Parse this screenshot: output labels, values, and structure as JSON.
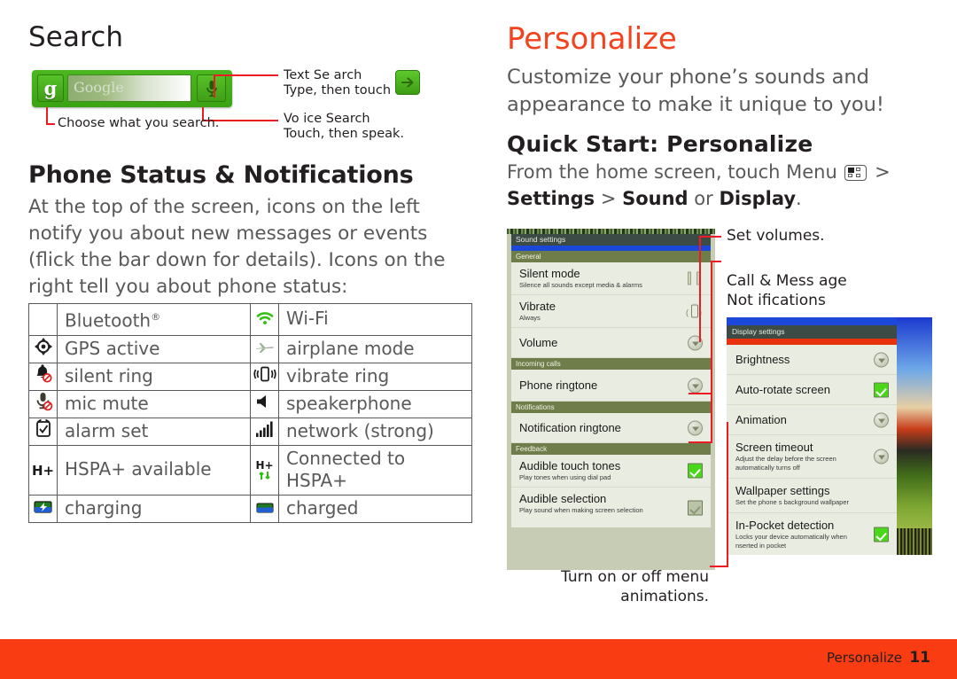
{
  "left": {
    "search_heading": "Search",
    "widget": {
      "g_letter": "g",
      "field_placeholder": "Google",
      "mic_icon": "microphone-icon",
      "g_icon": "google-source-icon"
    },
    "callouts": {
      "text_search_title": "Text Se arch",
      "text_search_sub": "Type, then touch",
      "go_icon": "go-arrow-icon",
      "voice_search_title": "Vo ice Search",
      "voice_search_sub": "Touch, then speak.",
      "choose_what": "Choose what you search."
    },
    "status_heading": "Phone Status & Notifications",
    "status_body": "At the top of the screen, icons on the left notify you about new messages or events (flick the bar down for details). Icons on the right tell you about phone status:",
    "table": {
      "rows": [
        {
          "left_icon": "bluetooth-icon",
          "left_label": "Bluetooth",
          "left_sup": "®",
          "right_icon": "wifi-icon",
          "right_label": "Wi-Fi"
        },
        {
          "left_icon": "gps-icon",
          "left_label": "GPS active",
          "left_sup": "",
          "right_icon": "airplane-icon",
          "right_label": "airplane mode"
        },
        {
          "left_icon": "silent-ring-icon",
          "left_label": "silent ring",
          "left_sup": "",
          "right_icon": "vibrate-icon",
          "right_label": "vibrate ring"
        },
        {
          "left_icon": "mic-mute-icon",
          "left_label": "mic mute",
          "left_sup": "",
          "right_icon": "speaker-icon",
          "right_label": "speakerphone"
        },
        {
          "left_icon": "alarm-icon",
          "left_label": "alarm set",
          "left_sup": "",
          "right_icon": "signal-bars-icon",
          "right_label": "network (strong)"
        },
        {
          "left_icon": "hspa-plus-icon",
          "left_label": "HSPA+ available",
          "left_sup": "",
          "right_icon": "hspa-connected-icon",
          "right_label": "Connected to HSPA+"
        },
        {
          "left_icon": "charging-icon",
          "left_label": "charging",
          "left_sup": "",
          "right_icon": "charged-icon",
          "right_label": "charged"
        }
      ],
      "hspa_glyph": "H+"
    }
  },
  "right": {
    "title": "Personalize",
    "intro": "Customize your phone’s sounds and appearance to make it unique to you!",
    "quick_start_title": "Quick Start: Personalize",
    "path_prefix": "From the home screen, touch Menu",
    "menu_icon": "menu-grid-icon",
    "path_gt1": ">",
    "path_settings": "Settings",
    "path_gt2": ">",
    "path_sound": "Sound",
    "path_or": "or",
    "path_display": "Display",
    "path_period": ".",
    "annotations": {
      "set_volumes": "Set volumes.",
      "call_msg_line1": "Call & Mess age",
      "call_msg_line2": "Not ifications",
      "turn_on_off_line1": "Turn on or off menu",
      "turn_on_off_line2": "animations."
    },
    "sound_shot": {
      "title": "Sound settings",
      "sections": [
        {
          "header": "General",
          "rows": [
            {
              "title": "Silent mode",
              "sub": "Silence all sounds except media & alarms",
              "ctrl": "slider-icon"
            },
            {
              "title": "Vibrate",
              "sub": "Always",
              "ctrl": "vibrate-icon"
            },
            {
              "title": "Volume",
              "sub": "",
              "ctrl": "disclosure-icon"
            }
          ]
        },
        {
          "header": "Incoming calls",
          "rows": [
            {
              "title": "Phone ringtone",
              "sub": "",
              "ctrl": "disclosure-icon"
            }
          ]
        },
        {
          "header": "Notifications",
          "rows": [
            {
              "title": "Notification ringtone",
              "sub": "",
              "ctrl": "disclosure-icon"
            }
          ]
        },
        {
          "header": "Feedback",
          "rows": [
            {
              "title": "Audible touch tones",
              "sub": "Play tones when using dial pad",
              "ctrl": "checkbox-on-icon"
            },
            {
              "title": "Audible selection",
              "sub": "Play sound when making screen selection",
              "ctrl": "checkbox-off-icon"
            }
          ]
        }
      ]
    },
    "display_shot": {
      "title": "Display settings",
      "rows": [
        {
          "title": "Brightness",
          "sub": "",
          "ctrl": "disclosure-icon"
        },
        {
          "title": "Auto-rotate screen",
          "sub": "",
          "ctrl": "checkbox-on-icon"
        },
        {
          "title": "Animation",
          "sub": "",
          "ctrl": "disclosure-icon"
        },
        {
          "title": "Screen timeout",
          "sub": "Adjust the delay before the screen automatically turns off",
          "ctrl": "disclosure-icon"
        },
        {
          "title": "Wallpaper settings",
          "sub": "Set the phone s background wallpaper",
          "ctrl": "none"
        },
        {
          "title": "In-Pocket detection",
          "sub": "Locks your device automatically when nserted in pocket",
          "ctrl": "checkbox-on-icon"
        }
      ]
    }
  },
  "footer": {
    "label": "Personalize",
    "page": "11",
    "bar_color": "#fa3c12"
  }
}
